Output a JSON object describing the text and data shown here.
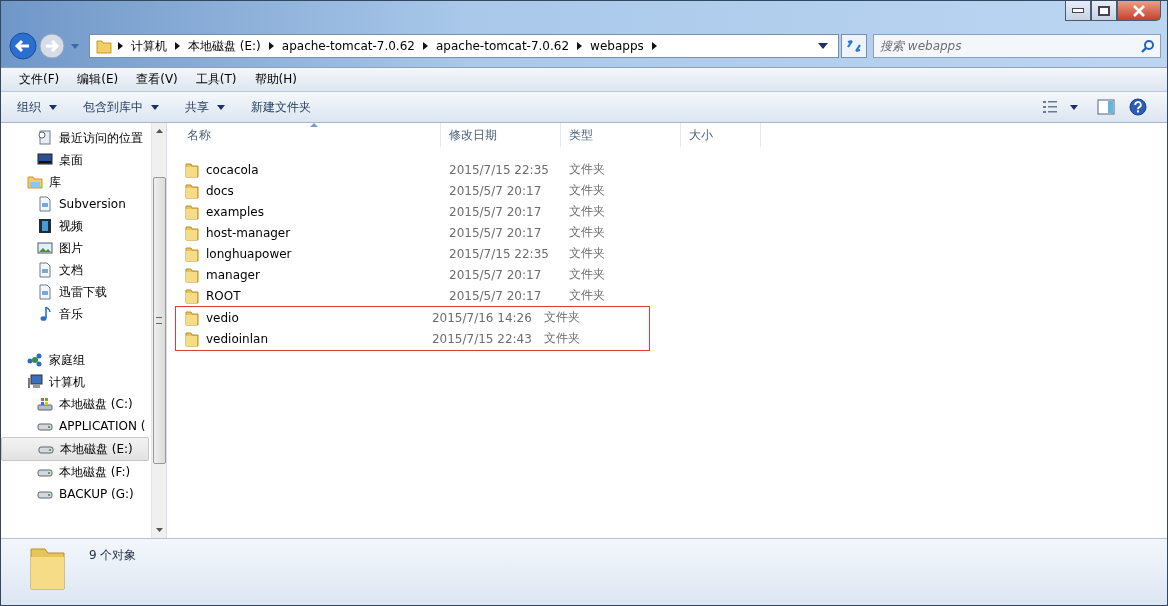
{
  "address_bar": {
    "crumbs": [
      "计算机",
      "本地磁盘 (E:)",
      "apache-tomcat-7.0.62",
      "apache-tomcat-7.0.62",
      "webapps"
    ]
  },
  "search": {
    "placeholder": "搜索 webapps"
  },
  "menu_bar": [
    "文件(F)",
    "编辑(E)",
    "查看(V)",
    "工具(T)",
    "帮助(H)"
  ],
  "toolbar": [
    {
      "label": "组织",
      "dropdown": true
    },
    {
      "label": "包含到库中",
      "dropdown": true
    },
    {
      "label": "共享",
      "dropdown": true
    },
    {
      "label": "新建文件夹",
      "dropdown": false
    }
  ],
  "sidebar": {
    "items": [
      {
        "label": "最近访问的位置",
        "selected": false
      },
      {
        "label": "桌面",
        "selected": false
      },
      {
        "label": "库",
        "selected": false,
        "children": [
          {
            "label": "Subversion",
            "selected": false
          },
          {
            "label": "视频",
            "selected": false
          },
          {
            "label": "图片",
            "selected": false
          },
          {
            "label": "文档",
            "selected": false
          },
          {
            "label": "迅雷下载",
            "selected": false
          },
          {
            "label": "音乐",
            "selected": false
          }
        ]
      },
      {
        "label": "家庭组",
        "selected": false
      },
      {
        "label": "计算机",
        "selected": false,
        "children": [
          {
            "label": "本地磁盘 (C:)",
            "selected": false
          },
          {
            "label": "APPLICATION (",
            "selected": false
          },
          {
            "label": "本地磁盘 (E:)",
            "selected": true
          },
          {
            "label": "本地磁盘 (F:)",
            "selected": false
          },
          {
            "label": "BACKUP (G:)",
            "selected": false
          }
        ]
      }
    ]
  },
  "table": {
    "columns": [
      {
        "label": "名称",
        "sorted": true
      },
      {
        "label": "修改日期",
        "sorted": false
      },
      {
        "label": "类型",
        "sorted": false
      },
      {
        "label": "大小",
        "sorted": false
      }
    ],
    "rows": [
      {
        "name": "cocacola",
        "date": "2015/7/15 22:35",
        "type": "文件夹",
        "boxed": false
      },
      {
        "name": "docs",
        "date": "2015/5/7 20:17",
        "type": "文件夹",
        "boxed": false
      },
      {
        "name": "examples",
        "date": "2015/5/7 20:17",
        "type": "文件夹",
        "boxed": false
      },
      {
        "name": "host-manager",
        "date": "2015/5/7 20:17",
        "type": "文件夹",
        "boxed": false
      },
      {
        "name": "longhuapower",
        "date": "2015/7/15 22:35",
        "type": "文件夹",
        "boxed": false
      },
      {
        "name": "manager",
        "date": "2015/5/7 20:17",
        "type": "文件夹",
        "boxed": false
      },
      {
        "name": "ROOT",
        "date": "2015/5/7 20:17",
        "type": "文件夹",
        "boxed": false
      },
      {
        "name": "vedio",
        "date": "2015/7/16 14:26",
        "type": "文件夹",
        "boxed": true
      },
      {
        "name": "vedioinlan",
        "date": "2015/7/15 22:43",
        "type": "文件夹",
        "boxed": true
      }
    ]
  },
  "status_bar": {
    "count": "9 个对象"
  }
}
